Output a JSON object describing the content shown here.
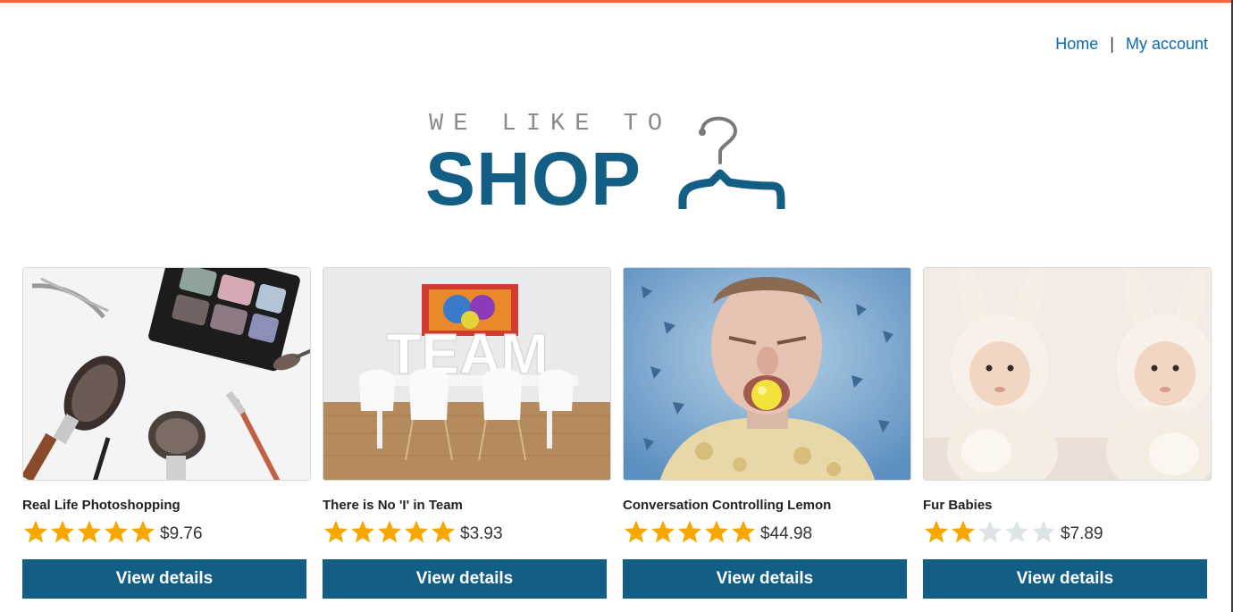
{
  "header": {
    "nav": {
      "home": "Home",
      "separator": "|",
      "my_account": "My account"
    }
  },
  "logo": {
    "tagline": "WE LIKE TO",
    "brand": "SHOP",
    "icon": "hanger-icon"
  },
  "colors": {
    "accent_top_bar": "#ff6633",
    "brand_blue": "#135e85",
    "link_blue": "#0a6bb5",
    "star_filled": "#f7a800",
    "star_empty": "#dde4e6"
  },
  "products": [
    {
      "title": "Real Life Photoshopping",
      "rating": 5,
      "max_rating": 5,
      "price": "$9.76",
      "button": "View details",
      "image": "makeup-brushes-image"
    },
    {
      "title": "There is No 'I' in Team",
      "rating": 5,
      "max_rating": 5,
      "price": "$3.93",
      "button": "View details",
      "image": "team-office-image"
    },
    {
      "title": "Conversation Controlling Lemon",
      "rating": 5,
      "max_rating": 5,
      "price": "$44.98",
      "button": "View details",
      "image": "lemon-face-image"
    },
    {
      "title": "Fur Babies",
      "rating": 2,
      "max_rating": 5,
      "price": "$7.89",
      "button": "View details",
      "image": "babies-bunny-image"
    }
  ]
}
